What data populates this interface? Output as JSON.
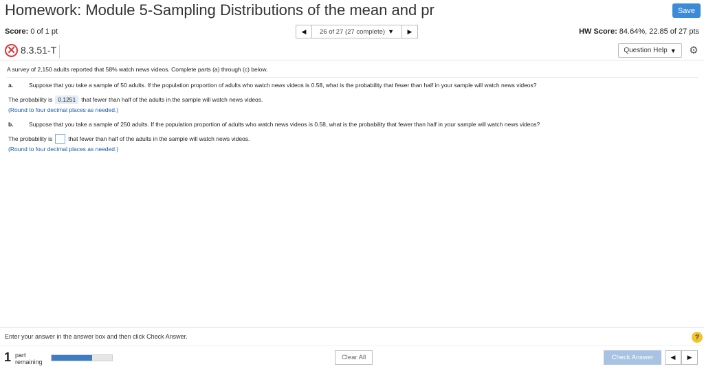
{
  "header": {
    "title": "Homework: Module 5-Sampling Distributions of the mean and pr",
    "save_label": "Save"
  },
  "score_row": {
    "score_label": "Score:",
    "score_value": "0 of 1 pt",
    "nav_text": "26 of 27 (27 complete)",
    "hw_score_label": "HW Score:",
    "hw_score_value": "84.64%, 22.85 of 27 pts"
  },
  "question": {
    "id": "8.3.51-T",
    "help_label": "Question Help",
    "intro": "A survey of 2,150 adults reported that 58% watch news videos. Complete parts (a) through (c) below.",
    "parts": [
      {
        "label": "a.",
        "text": "Suppose that you take a sample of 50 adults. If the population proportion of adults who watch news videos is 0.58, what is the probability that fewer than half in your sample will watch news videos?",
        "answer_prefix": "The probability is",
        "answer_value": "0.1251",
        "answer_suffix": "that fewer than half of the adults in the sample will watch news videos.",
        "hint": "(Round to four decimal places as needed.)"
      },
      {
        "label": "b.",
        "text": "Suppose that you take a sample of 250 adults. If the population proportion of adults who watch news videos is 0.58, what is the probability that fewer than half in your sample will watch news videos?",
        "answer_prefix": "The probability is",
        "answer_value": "",
        "answer_suffix": "that fewer than half of the adults in the sample will watch news videos.",
        "hint": "(Round to four decimal places as needed.)"
      }
    ]
  },
  "footer": {
    "instruction": "Enter your answer in the answer box and then click Check Answer.",
    "help_icon": "?",
    "parts_count": "1",
    "parts_label_line1": "part",
    "parts_label_line2": "remaining",
    "progress_fraction": 0.67,
    "clear_label": "Clear All",
    "check_label": "Check Answer"
  },
  "icons": {
    "prev": "◀",
    "next": "▶",
    "dropdown": "▼",
    "gear": "⚙",
    "wrong": "✕"
  },
  "colors": {
    "save_bg": "#3b8bd8",
    "check_bg": "#a8c3e1",
    "wrong": "#dd3333",
    "hint": "#1a5aa8",
    "progress": "#3c7dc4"
  }
}
